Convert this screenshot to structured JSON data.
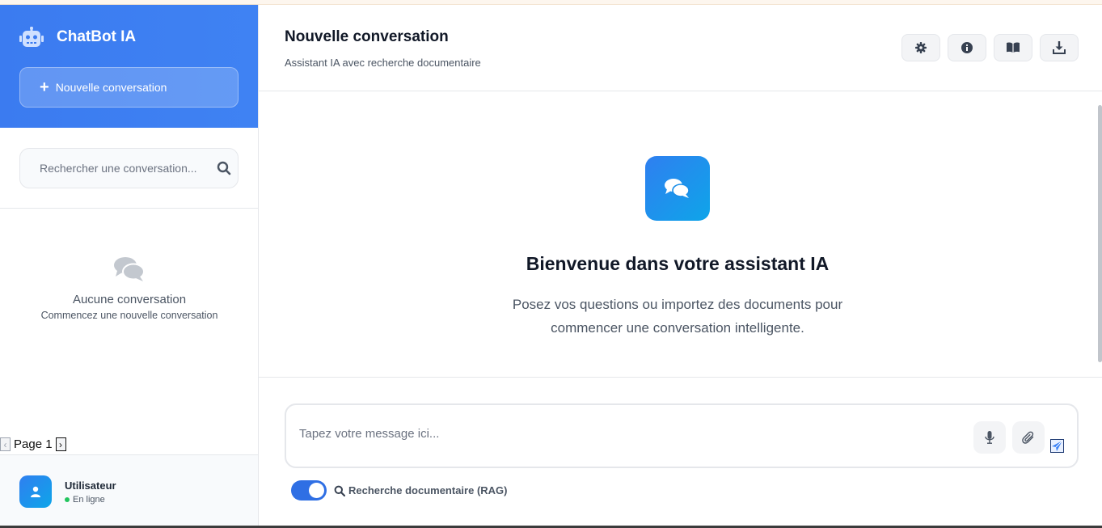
{
  "sidebar": {
    "brand": {
      "title": "ChatBot IA",
      "icon": "robot-icon"
    },
    "new_conversation_label": "Nouvelle conversation",
    "search": {
      "placeholder": "Rechercher une conversation..."
    },
    "empty": {
      "title": "Aucune conversation",
      "subtitle": "Commencez une nouvelle conversation"
    },
    "pager": {
      "label": "Page 1"
    },
    "user": {
      "name": "Utilisateur",
      "status": "En ligne"
    }
  },
  "header": {
    "title": "Nouvelle conversation",
    "subtitle": "Assistant IA avec recherche documentaire",
    "actions": [
      "settings-icon",
      "info-icon",
      "book-icon",
      "download-icon"
    ]
  },
  "welcome": {
    "title": "Bienvenue dans votre assistant IA",
    "text": "Posez vos questions ou importez des documents pour commencer une conversation intelligente."
  },
  "composer": {
    "placeholder": "Tapez votre message ici..."
  },
  "rag": {
    "label": "Recherche documentaire (RAG)",
    "enabled": true
  },
  "colors": {
    "accent": "#3b7bf0",
    "status_online": "#22c55e"
  }
}
